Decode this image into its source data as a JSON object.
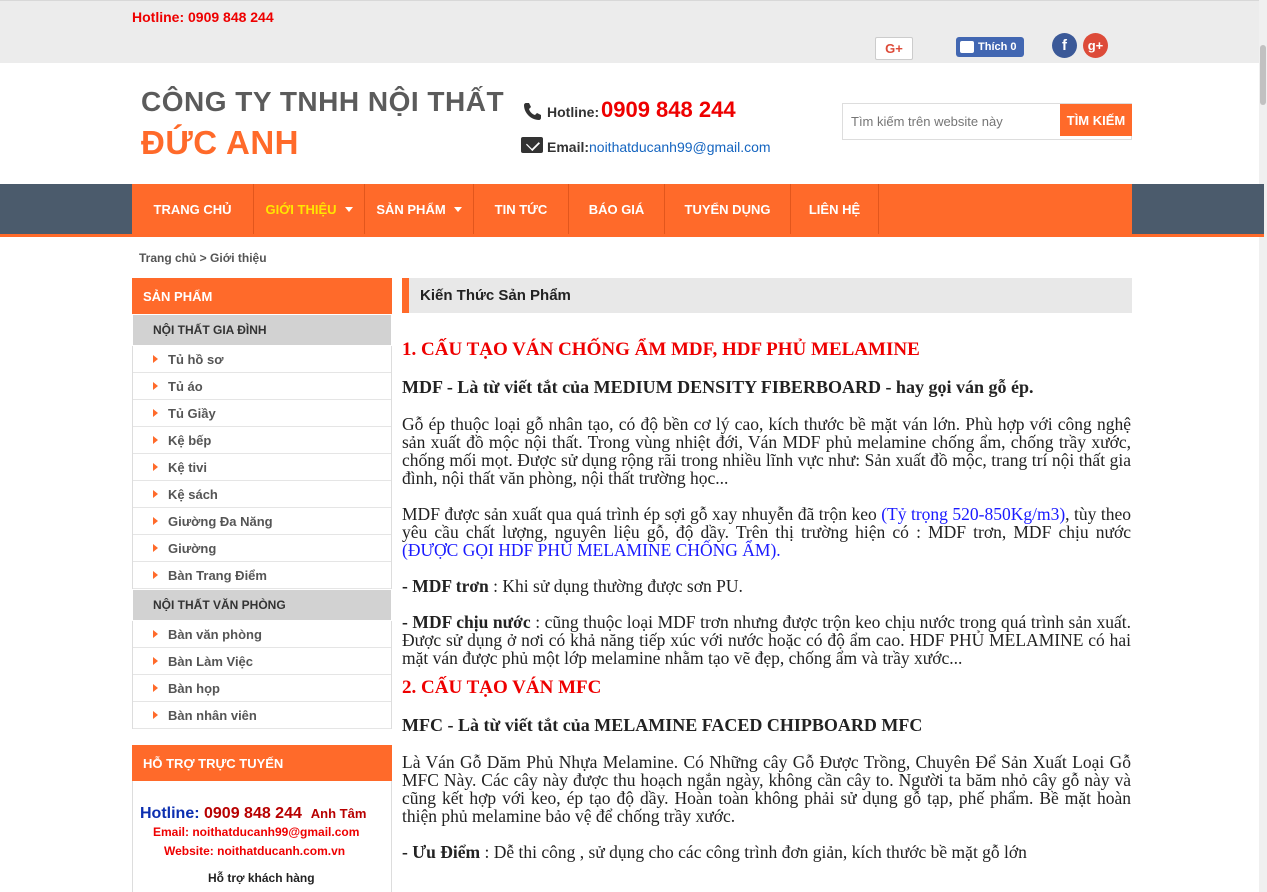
{
  "topbar": {
    "hotline": "Hotline: 0909 848 244",
    "gplus_small": "G+",
    "fb_like": "Thích 0",
    "social_fb": "f",
    "social_gp": "g+"
  },
  "header": {
    "company_line1": "CÔNG TY TNHH NỘI THẤT",
    "company_line2": "ĐỨC ANH",
    "hotline_label": "Hotline:",
    "hotline_number": "0909 848 244",
    "email_label": "Email:",
    "email_value": "noithatducanh99@gmail.com",
    "search_placeholder": "Tìm kiếm trên website này",
    "search_button": "TÌM KIẾM"
  },
  "nav": {
    "items": [
      {
        "label": "TRANG CHỦ"
      },
      {
        "label": "GIỚI THIỆU"
      },
      {
        "label": "SẢN PHẨM"
      },
      {
        "label": "TIN TỨC"
      },
      {
        "label": "BÁO GIÁ"
      },
      {
        "label": "TUYỂN DỤNG"
      },
      {
        "label": "LIÊN HỆ"
      }
    ]
  },
  "breadcrumb": {
    "home": "Trang chủ",
    "sep": " > ",
    "current": "Giới thiệu"
  },
  "sidebar": {
    "header": "SẢN PHẨM",
    "cat1": "NỘI THẤT GIA ĐÌNH",
    "cat1_items": [
      "Tủ hồ sơ",
      "Tủ áo",
      "Tủ Giầy",
      "Kệ bếp",
      "Kệ tivi",
      "Kệ sách",
      "Giường Đa Năng",
      "Giường",
      "Bàn Trang Điểm"
    ],
    "cat2": "NỘI THẤT VĂN PHÒNG",
    "cat2_items": [
      "Bàn văn phòng",
      "Bàn Làm Việc",
      "Bàn họp",
      "Bàn nhân viên"
    ],
    "support_header": "HỖ TRỢ TRỰC TUYẾN",
    "support_hotline_label": "Hotline: ",
    "support_hotline_number": "0909 848 244",
    "support_name": "Anh Tâm",
    "support_email": "Email: noithatducanh99@gmail.com",
    "support_website": "Website: noithatducanh.com.vn",
    "support_help": "Hỗ trợ khách hàng"
  },
  "content": {
    "header": "Kiến Thức Sản Phẩm",
    "h1": "1. CẤU TẠO VÁN CHỐNG ẨM MDF, HDF PHỦ MELAMINE",
    "p1": "MDF - Là từ viết tắt của MEDIUM DENSITY FIBERBOARD - hay gọi ván gỗ ép.",
    "p2": "Gỗ ép thuộc loại gỗ nhân tạo, có độ bền cơ lý cao, kích thước bề mặt ván lớn. Phù hợp với công nghệ sản xuất đồ mộc nội thất. Trong vùng nhiệt đới, Ván MDF phủ melamine chống ẩm, chống trầy xước, chống mối mọt. Được sử dụng rộng rãi trong nhiều lĩnh vực như: Sản xuất đồ mộc, trang trí nội thất gia đình, nội thất văn phòng, nội thất trường học...",
    "p3a": "MDF được sản xuất qua quá trình ép sợi gỗ xay nhuyễn đã trộn keo ",
    "p3b": "(Tỷ trọng 520-850Kg/m3)",
    "p3c": ", tùy theo yêu cầu chất lượng, nguyên liệu gỗ, độ dầy. Trên thị trường hiện có : MDF trơn, MDF chịu nước ",
    "p3d": "(ĐƯỢC GỌI HDF PHỦ MELAMINE CHỐNG ẨM).",
    "p4a": "- MDF trơn",
    "p4b": " : Khi sử dụng thường được sơn PU.",
    "p5a": "- MDF chịu nước",
    "p5b": " : cũng thuộc loại MDF trơn nhưng được trộn keo chịu nước trong quá trình sản xuất. Được sử dụng ở nơi có khả năng tiếp xúc với nước hoặc có độ ẩm cao. HDF PHỦ MELAMINE có hai mặt ván được phủ một lớp melamine nhằm tạo vẽ đẹp, chống ẩm và trầy xước...",
    "h2": "2. CẤU TẠO VÁN MFC",
    "p6": "MFC - Là từ viết tắt của  MELAMINE FACED CHIPBOARD MFC",
    "p7": "Là Ván Gỗ Dăm Phủ Nhựa Melamine. Có Những cây Gỗ Được Trồng, Chuyên Để Sản Xuất Loại Gỗ MFC Này. Các cây này được thu hoạch ngắn ngày, không cần cây to. Người ta băm nhỏ cây gỗ này và cũng kết hợp với keo, ép tạo độ dầy. Hoàn toàn không phải sử dụng gỗ tạp, phế phẩm. Bề mặt hoàn thiện phủ melamine bảo vệ để chống trầy xước.",
    "p8a": " - Ưu Điểm",
    "p8b": " : Dễ thi công , sử dụng cho các công trình đơn giản, kích thước bề mặt gỗ lớn"
  }
}
